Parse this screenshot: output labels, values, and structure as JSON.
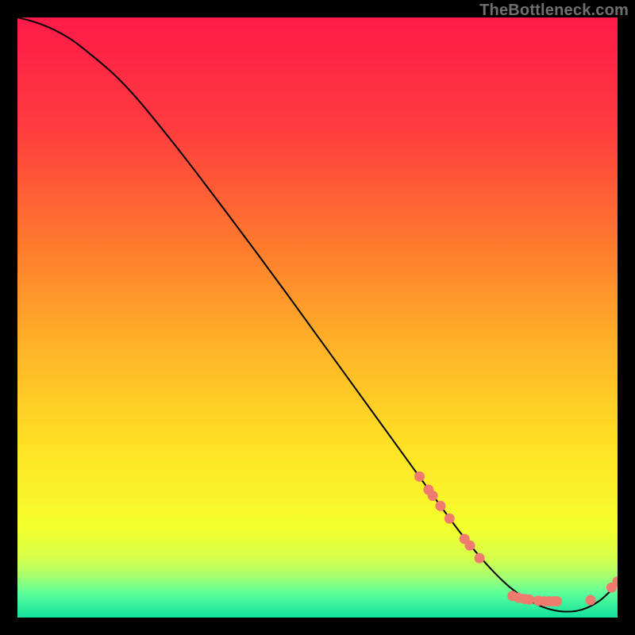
{
  "watermark": "TheBottleneck.com",
  "chart_data": {
    "type": "line",
    "title": "",
    "xlabel": "",
    "ylabel": "",
    "xlim": [
      0,
      100
    ],
    "ylim": [
      0,
      100
    ],
    "background_gradient": {
      "stops": [
        {
          "pct": 0,
          "color": "#ff1a49"
        },
        {
          "pct": 18,
          "color": "#ff3b3f"
        },
        {
          "pct": 38,
          "color": "#ff7a2e"
        },
        {
          "pct": 55,
          "color": "#ffb327"
        },
        {
          "pct": 72,
          "color": "#ffe324"
        },
        {
          "pct": 85,
          "color": "#f4ff2c"
        },
        {
          "pct": 90,
          "color": "#d6ff4a"
        },
        {
          "pct": 93,
          "color": "#a8ff6e"
        },
        {
          "pct": 96,
          "color": "#5bff9a"
        },
        {
          "pct": 100,
          "color": "#11e09e"
        }
      ]
    },
    "series": [
      {
        "name": "bottleneck-curve",
        "color": "#000000",
        "x": [
          0,
          3,
          6,
          9,
          12,
          16,
          20,
          25,
          30,
          35,
          40,
          45,
          50,
          55,
          60,
          65,
          70,
          73,
          76,
          79,
          82,
          85,
          88,
          91,
          94,
          97,
          100
        ],
        "y": [
          100,
          99.2,
          98.0,
          96.3,
          94.0,
          90.6,
          86.4,
          80.3,
          73.9,
          67.3,
          60.6,
          53.8,
          46.9,
          40.0,
          33.1,
          26.2,
          19.3,
          15.2,
          11.4,
          8.0,
          5.1,
          3.0,
          1.6,
          1.0,
          1.3,
          2.8,
          5.6
        ]
      }
    ],
    "scatter": {
      "name": "data-points",
      "color": "#ef7b6f",
      "radius": 6.5,
      "points": [
        {
          "x": 67.0,
          "y": 23.5
        },
        {
          "x": 68.5,
          "y": 21.3
        },
        {
          "x": 69.2,
          "y": 20.3
        },
        {
          "x": 70.5,
          "y": 18.6
        },
        {
          "x": 72.0,
          "y": 16.5
        },
        {
          "x": 74.5,
          "y": 13.1
        },
        {
          "x": 75.4,
          "y": 12.0
        },
        {
          "x": 77.0,
          "y": 9.9
        },
        {
          "x": 82.5,
          "y": 3.6
        },
        {
          "x": 83.5,
          "y": 3.3
        },
        {
          "x": 84.5,
          "y": 3.1
        },
        {
          "x": 85.3,
          "y": 3.0
        },
        {
          "x": 86.8,
          "y": 2.8
        },
        {
          "x": 87.8,
          "y": 2.7
        },
        {
          "x": 88.6,
          "y": 2.7
        },
        {
          "x": 89.3,
          "y": 2.7
        },
        {
          "x": 89.9,
          "y": 2.7
        },
        {
          "x": 95.5,
          "y": 2.9
        },
        {
          "x": 99.0,
          "y": 5.0
        },
        {
          "x": 100.0,
          "y": 6.0
        }
      ]
    }
  }
}
